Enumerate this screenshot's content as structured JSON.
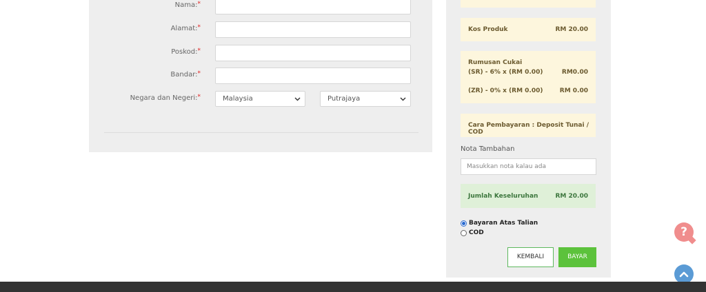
{
  "form": {
    "fields": [
      {
        "label": "Nama:",
        "required": "*",
        "value": ""
      },
      {
        "label": "Alamat:",
        "required": "*",
        "value": ""
      },
      {
        "label": "Poskod:",
        "required": "*",
        "value": ""
      },
      {
        "label": "Bandar:",
        "required": "*",
        "value": ""
      }
    ],
    "country_state": {
      "label": "Negara dan Negeri:",
      "required": "*",
      "country": "Malaysia",
      "state": "Putrajaya"
    }
  },
  "summary": {
    "kos_produk": {
      "label": "Kos Produk",
      "value": "RM 20.00"
    },
    "cukai": {
      "title": "Rumusan Cukai",
      "sr_label": "(SR) - 6% x (RM 0.00)",
      "sr_value": "RM0.00",
      "zr_label": "(ZR) - 0% x (RM 0.00)",
      "zr_value": "RM 0.00"
    },
    "cara_pembayaran": "Cara Pembayaran : Deposit Tunai / COD",
    "nota": {
      "title": "Nota Tambahan",
      "placeholder": "Masukkan nota kalau ada"
    },
    "jumlah": {
      "label": "Jumlah Keseluruhan",
      "value": "RM 20.00"
    },
    "payment_options": [
      {
        "label": "Bayaran Atas Talian",
        "checked": true
      },
      {
        "label": "COD",
        "checked": false
      }
    ],
    "buttons": {
      "kembali": "KEMBALI",
      "bayar": "BAYAR"
    }
  },
  "floating": {
    "help_glyph": "?",
    "help_icon": "question-icon",
    "top_icon": "chevron-up-icon"
  },
  "colors": {
    "accent_green": "#5cc23c",
    "help_red": "#f08d8d",
    "scroll_blue": "#5b9bd5",
    "card_yellow": "#fdf6dd",
    "total_green": "#dff0d8"
  }
}
